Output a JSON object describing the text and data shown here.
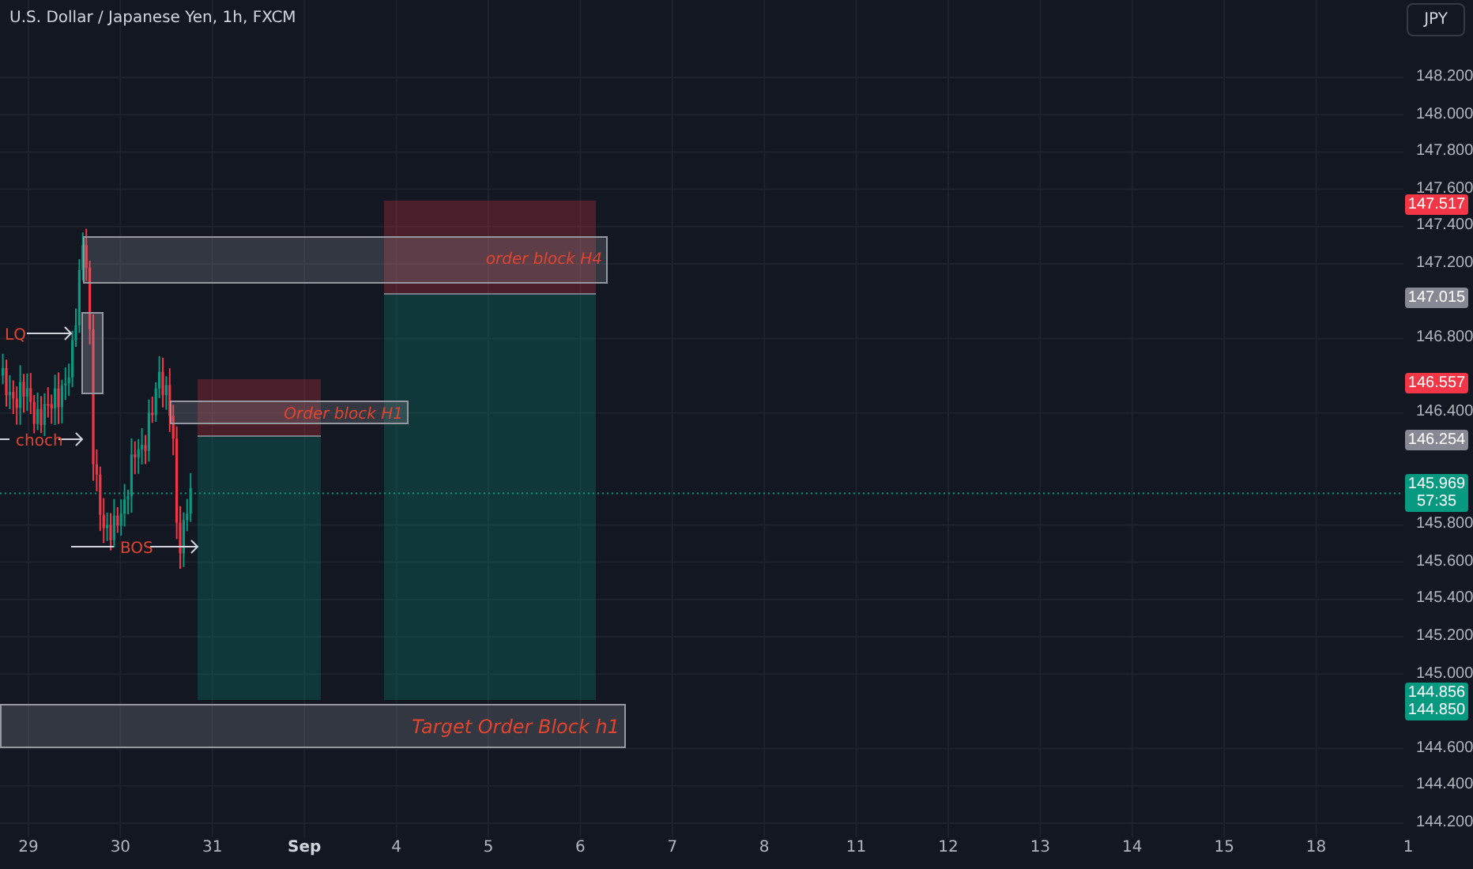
{
  "chart": {
    "title": "U.S. Dollar / Japanese Yen, 1h, FXCM",
    "currency_button": "JPY",
    "price_ticks": [
      "148.200",
      "148.000",
      "147.800",
      "147.600",
      "147.400",
      "147.200",
      "146.800",
      "146.400",
      "145.800",
      "145.600",
      "145.400",
      "145.200",
      "145.000",
      "144.600",
      "144.400",
      "144.200"
    ],
    "price_badges": [
      {
        "kind": "loss",
        "lines": [
          "147.517"
        ]
      },
      {
        "kind": "entry",
        "lines": [
          "147.015"
        ]
      },
      {
        "kind": "loss",
        "lines": [
          "146.557"
        ]
      },
      {
        "kind": "entry",
        "lines": [
          "146.254"
        ]
      },
      {
        "kind": "last",
        "lines": [
          "145.969",
          "57:35"
        ]
      },
      {
        "kind": "target",
        "lines": [
          "144.856",
          "144.850"
        ]
      }
    ],
    "date_ticks": [
      {
        "label": "29",
        "bold": false
      },
      {
        "label": "30",
        "bold": false
      },
      {
        "label": "31",
        "bold": false
      },
      {
        "label": "Sep",
        "bold": true
      },
      {
        "label": "4",
        "bold": false
      },
      {
        "label": "5",
        "bold": false
      },
      {
        "label": "6",
        "bold": false
      },
      {
        "label": "7",
        "bold": false
      },
      {
        "label": "8",
        "bold": false
      },
      {
        "label": "11",
        "bold": false
      },
      {
        "label": "12",
        "bold": false
      },
      {
        "label": "13",
        "bold": false
      },
      {
        "label": "14",
        "bold": false
      },
      {
        "label": "15",
        "bold": false
      },
      {
        "label": "18",
        "bold": false
      },
      {
        "label": "1",
        "bold": false
      }
    ],
    "annotations": [
      "order block H4",
      "LQ",
      "Order block H1",
      "choch",
      "BOS",
      "Target Order Block h1"
    ]
  }
}
